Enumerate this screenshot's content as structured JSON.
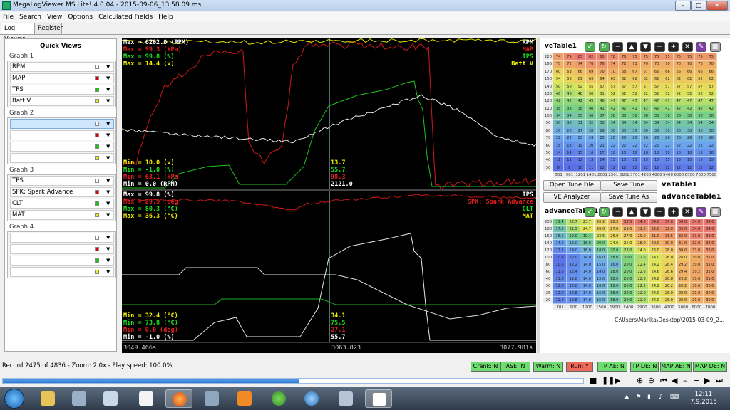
{
  "window": {
    "title": "MegaLogViewer MS Lite! 4.0.04 - 2015-09-06_13.58.09.msl"
  },
  "menu": [
    "File",
    "Search",
    "View",
    "Options",
    "Calculated Fields",
    "Help"
  ],
  "tabs": [
    "Log Viewer",
    "Register"
  ],
  "quick_views": {
    "title": "Quick Views",
    "groups": [
      {
        "label": "Graph 1",
        "items": [
          {
            "name": "RPM",
            "color": "#ffffff"
          },
          {
            "name": "MAP",
            "color": "#e00000"
          },
          {
            "name": "TPS",
            "color": "#00d000"
          },
          {
            "name": "Batt V",
            "color": "#f0f000"
          }
        ]
      },
      {
        "label": "Graph 2",
        "items": [
          {
            "name": "",
            "color": "#ffffff"
          },
          {
            "name": "",
            "color": "#e00000"
          },
          {
            "name": "",
            "color": "#00d000"
          },
          {
            "name": "",
            "color": "#f0f000"
          }
        ]
      },
      {
        "label": "Graph 3",
        "items": [
          {
            "name": "TPS",
            "color": "#ffffff"
          },
          {
            "name": "SPK: Spark Advance",
            "color": "#e00000"
          },
          {
            "name": "CLT",
            "color": "#00d000"
          },
          {
            "name": "MAT",
            "color": "#f0f000"
          }
        ]
      },
      {
        "label": "Graph 4",
        "items": [
          {
            "name": "",
            "color": "#ffffff"
          },
          {
            "name": "",
            "color": "#e00000"
          },
          {
            "name": "",
            "color": "#00d000"
          },
          {
            "name": "",
            "color": "#f0f000"
          }
        ]
      }
    ]
  },
  "graph1": {
    "max_labels": [
      {
        "text": "Max = 6202.0 (RPM)",
        "color": "#ffffff"
      },
      {
        "text": "Max = 99.3 (kPa)",
        "color": "#e02020"
      },
      {
        "text": "Max = 99.8 (%)",
        "color": "#20e020"
      },
      {
        "text": "Max = 14.4 (v)",
        "color": "#f0f000"
      }
    ],
    "min_labels": [
      {
        "text": "Min = 10.0 (v)",
        "color": "#f0f000"
      },
      {
        "text": "Min = -1.0 (%)",
        "color": "#20e020"
      },
      {
        "text": "Min = 63.1 (kPa)",
        "color": "#e02020"
      },
      {
        "text": "Min = 0.0 (RPM)",
        "color": "#ffffff"
      }
    ],
    "cursor_values": [
      {
        "text": "13.7",
        "color": "#f0f000"
      },
      {
        "text": "55.7",
        "color": "#20e020"
      },
      {
        "text": "98.3",
        "color": "#e02020"
      },
      {
        "text": "2121.0",
        "color": "#ffffff"
      }
    ],
    "legend": [
      {
        "text": "RPM",
        "color": "#ffffff"
      },
      {
        "text": "MAP",
        "color": "#e02020"
      },
      {
        "text": "TPS",
        "color": "#20e020"
      },
      {
        "text": "Batt V",
        "color": "#f0f000"
      }
    ]
  },
  "graph2": {
    "max_labels": [
      {
        "text": "Max = 99.8 (%)",
        "color": "#ffffff"
      },
      {
        "text": "Max = 29.5 (deg)",
        "color": "#e02020"
      },
      {
        "text": "Max = 80.3 (°C)",
        "color": "#20e020"
      },
      {
        "text": "Max = 36.3 (°C)",
        "color": "#f0f000"
      }
    ],
    "min_labels": [
      {
        "text": "Min = 32.4 (°C)",
        "color": "#f0f000"
      },
      {
        "text": "Min = 73.8 (°C)",
        "color": "#20e020"
      },
      {
        "text": "Min = 0.0 (deg)",
        "color": "#e02020"
      },
      {
        "text": "Min = -1.0 (%)",
        "color": "#ffffff"
      }
    ],
    "cursor_values": [
      {
        "text": "34.1",
        "color": "#f0f000"
      },
      {
        "text": "75.5",
        "color": "#20e020"
      },
      {
        "text": "27.1",
        "color": "#e02020"
      },
      {
        "text": "55.7",
        "color": "#ffffff"
      }
    ],
    "legend": [
      {
        "text": "TPS",
        "color": "#ffffff"
      },
      {
        "text": "SPK: Spark Advance",
        "color": "#e02020"
      },
      {
        "text": "CLT",
        "color": "#20e020"
      },
      {
        "text": "MAT",
        "color": "#f0f000"
      }
    ]
  },
  "time_axis": {
    "start": "3049.466s",
    "cursor": "3063.823",
    "end": "3077.981s"
  },
  "ve_table": {
    "title": "veTable1",
    "label": "veTable1",
    "rows": [
      "220",
      "195",
      "170",
      "150",
      "140",
      "130",
      "120",
      "110",
      "100",
      "90",
      "80",
      "70",
      "60",
      "50",
      "40",
      "30"
    ],
    "cols": [
      "501",
      "901",
      "1201",
      "1401",
      "2001",
      "2501",
      "3101",
      "3701",
      "4200",
      "4800",
      "5400",
      "6000",
      "6500",
      "7000",
      "7500"
    ],
    "values": [
      [
        74,
        79,
        83,
        82,
        80,
        78,
        76,
        75,
        75,
        75,
        75,
        75,
        75,
        75,
        75
      ],
      [
        70,
        72,
        74,
        76,
        76,
        74,
        72,
        71,
        70,
        70,
        70,
        70,
        70,
        70,
        70
      ],
      [
        60,
        63,
        66,
        69,
        70,
        70,
        68,
        67,
        67,
        66,
        66,
        66,
        66,
        66,
        66
      ],
      [
        54,
        58,
        61,
        63,
        64,
        63,
        62,
        62,
        62,
        62,
        62,
        62,
        62,
        62,
        62
      ],
      [
        50,
        50,
        52,
        55,
        57,
        57,
        57,
        57,
        57,
        57,
        57,
        57,
        57,
        57,
        57
      ],
      [
        46,
        46,
        48,
        50,
        51,
        52,
        52,
        52,
        52,
        52,
        52,
        52,
        52,
        52,
        52
      ],
      [
        42,
        42,
        42,
        45,
        46,
        47,
        47,
        47,
        47,
        47,
        47,
        47,
        47,
        47,
        47
      ],
      [
        38,
        38,
        38,
        40,
        41,
        42,
        42,
        42,
        42,
        42,
        42,
        42,
        42,
        42,
        42
      ],
      [
        34,
        34,
        35,
        36,
        37,
        38,
        38,
        38,
        38,
        38,
        38,
        38,
        38,
        38,
        38
      ],
      [
        30,
        30,
        31,
        32,
        33,
        34,
        34,
        34,
        34,
        34,
        34,
        34,
        34,
        34,
        34
      ],
      [
        26,
        26,
        27,
        28,
        29,
        30,
        30,
        30,
        30,
        30,
        30,
        30,
        30,
        30,
        30
      ],
      [
        22,
        22,
        23,
        24,
        25,
        26,
        26,
        26,
        26,
        26,
        26,
        26,
        26,
        26,
        26
      ],
      [
        18,
        18,
        19,
        20,
        21,
        22,
        22,
        22,
        22,
        22,
        22,
        22,
        22,
        22,
        22
      ],
      [
        14,
        14,
        15,
        16,
        17,
        18,
        18,
        18,
        18,
        18,
        18,
        18,
        18,
        18,
        18
      ],
      [
        11,
        11,
        12,
        13,
        14,
        15,
        15,
        15,
        15,
        15,
        15,
        15,
        15,
        15,
        15
      ],
      [
        9,
        9,
        10,
        11,
        12,
        12,
        12,
        12,
        12,
        12,
        12,
        12,
        12,
        12,
        12
      ]
    ]
  },
  "advance_table": {
    "title": "advanceTable1",
    "label": "advanceTable1",
    "rows": [
      "200",
      "180",
      "160",
      "140",
      "120",
      "100",
      "80",
      "60",
      "40",
      "30",
      "25",
      "20"
    ],
    "cols": [
      "701",
      "900",
      "1200",
      "1500",
      "1900",
      "2400",
      "2900",
      "3600",
      "4200",
      "5000",
      "6000",
      "7000"
    ],
    "values": [
      [
        19.4,
        22.7,
        23.7,
        26.2,
        28.5,
        33.5,
        34.0,
        34.0,
        34.0,
        34.0,
        34.0,
        34.0
      ],
      [
        17.5,
        21.5,
        24.7,
        26.0,
        27.0,
        29.0,
        31.0,
        32.0,
        32.0,
        33.0,
        34.0,
        34.0
      ],
      [
        16.5,
        19.0,
        19.4,
        23.5,
        26.0,
        27.0,
        29.0,
        31.0,
        31.5,
        32.0,
        33.0,
        33.0
      ],
      [
        14.0,
        16.0,
        18.0,
        20.0,
        24.0,
        25.0,
        28.0,
        29.0,
        30.0,
        31.0,
        32.0,
        32.0
      ],
      [
        12.1,
        14.0,
        16.0,
        18.0,
        20.0,
        22.0,
        24.0,
        26.0,
        28.0,
        30.0,
        31.0,
        32.0
      ],
      [
        10.4,
        12.0,
        14.0,
        16.0,
        18.0,
        20.0,
        22.0,
        24.0,
        26.0,
        28.0,
        30.0,
        31.0
      ],
      [
        10.5,
        12.2,
        14.0,
        15.0,
        16.0,
        20.0,
        22.4,
        24.2,
        26.4,
        29.2,
        30.0,
        31.0
      ],
      [
        11.0,
        12.4,
        14.0,
        14.0,
        18.0,
        20.0,
        22.6,
        24.6,
        26.6,
        29.4,
        30.2,
        31.0
      ],
      [
        11.8,
        12.8,
        14.0,
        15.0,
        18.0,
        20.0,
        22.8,
        24.8,
        26.8,
        29.2,
        30.0,
        31.0
      ],
      [
        12.0,
        12.8,
        14.0,
        16.0,
        18.0,
        20.0,
        22.2,
        24.2,
        26.2,
        28.2,
        30.0,
        30.0
      ],
      [
        12.0,
        12.8,
        14.0,
        16.0,
        18.0,
        20.0,
        22.0,
        24.0,
        26.0,
        28.0,
        29.8,
        30.0
      ],
      [
        12.0,
        12.8,
        14.0,
        16.0,
        18.0,
        20.0,
        22.0,
        24.0,
        26.0,
        28.0,
        29.8,
        30.0
      ]
    ]
  },
  "buttons": {
    "open_tune": "Open Tune File",
    "save_tune": "Save Tune",
    "ve_analyzer": "VE Analyzer",
    "save_tune_as": "Save Tune As"
  },
  "tune_path": "C:\\Users\\Marika\\Desktop\\2015-03-09_2...",
  "status": {
    "text": "Record 2475 of 4836 - Zoom: 2.0x - Play speed: 100.0%",
    "flags": [
      {
        "text": "Crank: N",
        "color": "#6edc6e"
      },
      {
        "text": "ASE: N",
        "color": "#6edc6e"
      },
      {
        "text": "Warm: N",
        "color": "#6edc6e"
      },
      {
        "text": "Run: Y",
        "color": "#ec6a5a"
      },
      {
        "text": "TP AE: N",
        "color": "#6edc6e"
      },
      {
        "text": "TP DE: N",
        "color": "#6edc6e"
      },
      {
        "text": "MAP AE: N",
        "color": "#6edc6e"
      },
      {
        "text": "MAP DE: N",
        "color": "#6edc6e"
      }
    ],
    "progress": 0.51
  },
  "clock": {
    "time": "12:11",
    "date": "7.9.2015"
  }
}
